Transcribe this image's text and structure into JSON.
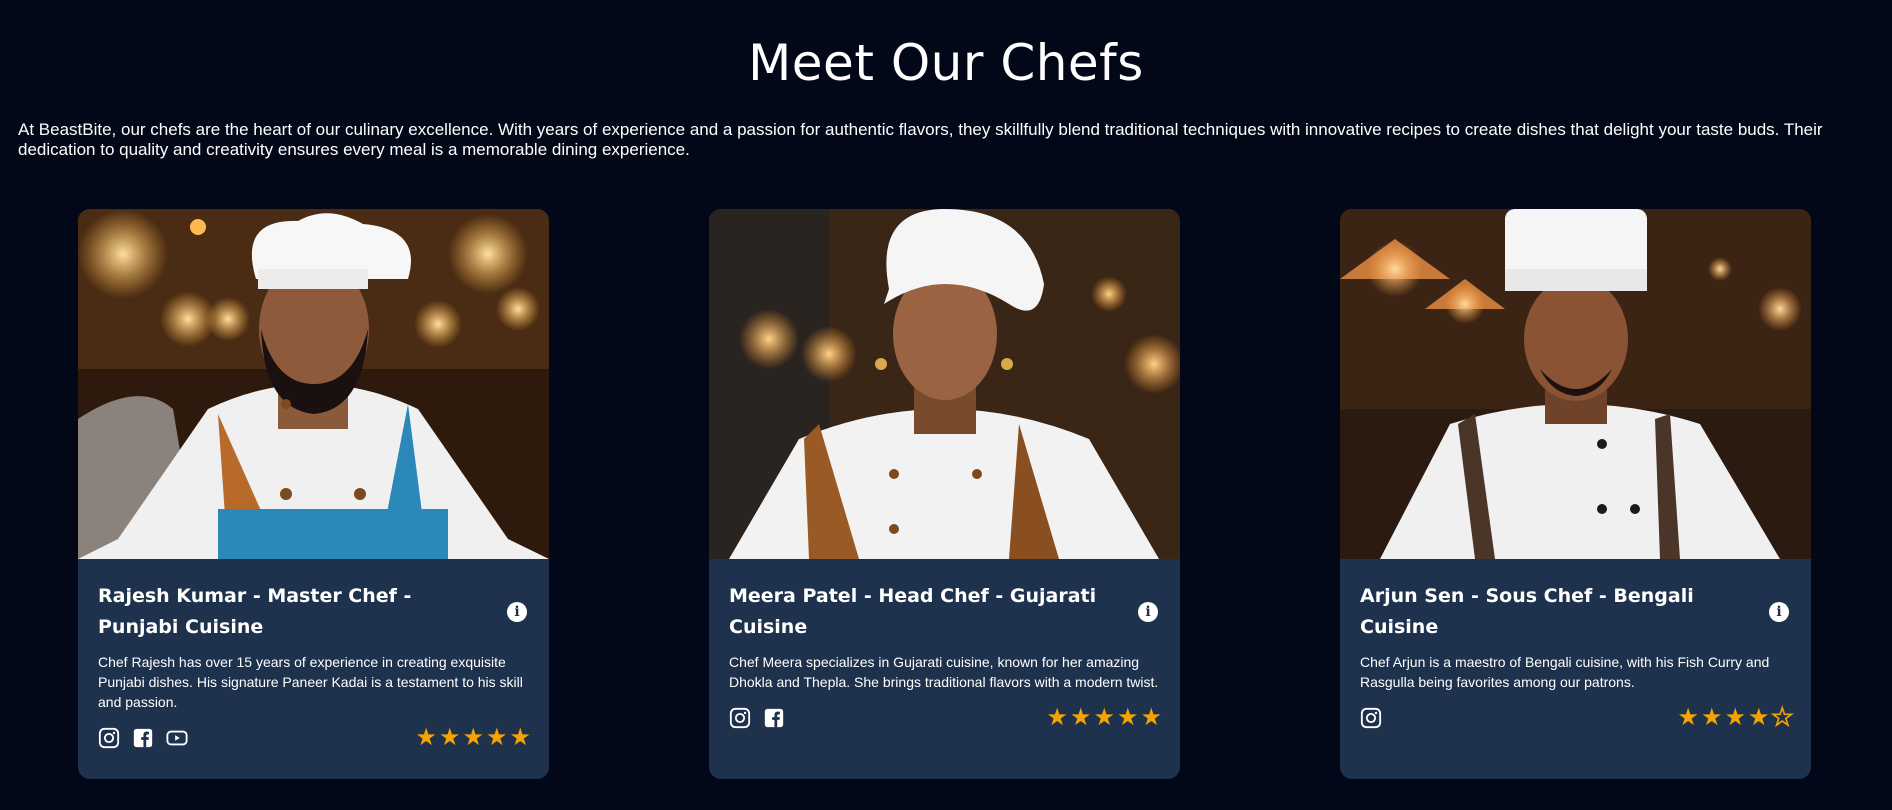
{
  "heading": "Meet Our Chefs",
  "intro": "At BeastBite, our chefs are the heart of our culinary excellence. With years of experience and a passion for authentic flavors, they skillfully blend traditional techniques with innovative recipes to create dishes that delight your taste buds. Their dedication to quality and creativity ensures every meal is a memorable dining experience.",
  "colors": {
    "background": "#020817",
    "card": "#1e314d",
    "star": "#f5a300",
    "text": "#ffffff"
  },
  "chefs": [
    {
      "name": "Rajesh Kumar - Master Chef - Punjabi Cuisine",
      "description": "Chef Rajesh has over 15 years of experience in creating exquisite Punjabi dishes. His signature Paneer Kadai is a testament to his skill and passion.",
      "info_icon": "info-circle-icon",
      "social": [
        "instagram-icon",
        "facebook-icon",
        "youtube-icon"
      ],
      "rating": 5,
      "rating_max": 5,
      "photo": "chef-photo-white-toque-blue-apron"
    },
    {
      "name": "Meera Patel - Head Chef - Gujarati Cuisine",
      "description": "Chef Meera specializes in Gujarati cuisine, known for her amazing Dhokla and Thepla. She brings traditional flavors with a modern twist.",
      "info_icon": "info-circle-icon",
      "social": [
        "instagram-icon",
        "facebook-icon"
      ],
      "rating": 5,
      "rating_max": 5,
      "photo": "chef-photo-white-headwrap-bronze-sash"
    },
    {
      "name": "Arjun Sen - Sous Chef - Bengali Cuisine",
      "description": "Chef Arjun is a maestro of Bengali cuisine, with his Fish Curry and Rasgulla being favorites among our patrons.",
      "info_icon": "info-circle-icon",
      "social": [
        "instagram-icon"
      ],
      "rating": 4,
      "rating_max": 5,
      "photo": "chef-photo-tall-toque-dark-apron"
    }
  ]
}
